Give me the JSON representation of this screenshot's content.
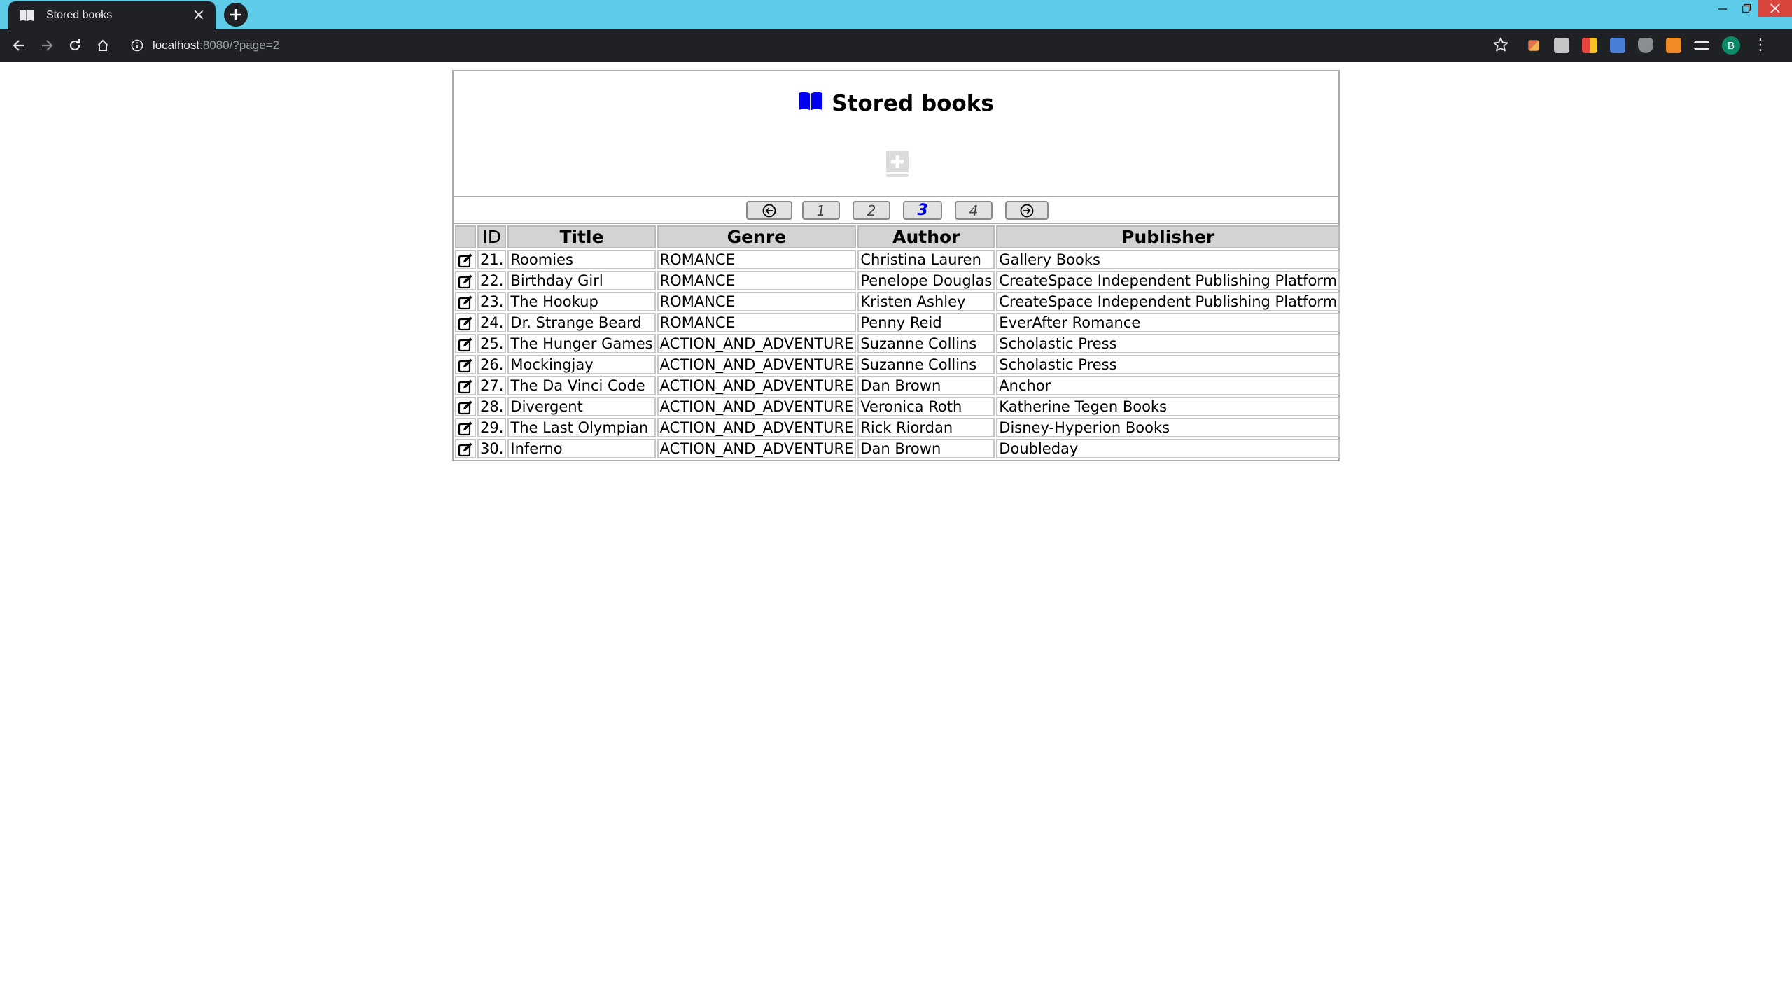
{
  "browser": {
    "tab_title": "Stored books",
    "url_host": "localhost",
    "url_rest": ":8080/?page=2",
    "profile_initial": "B"
  },
  "page": {
    "title": "Stored books",
    "pagination": {
      "prev_icon": "arrow-left-circle-icon",
      "next_icon": "arrow-right-circle-icon",
      "pages": [
        "1",
        "2",
        "3",
        "4"
      ],
      "current": "3"
    },
    "table": {
      "headers": {
        "id": "ID",
        "title": "Title",
        "genre": "Genre",
        "author": "Author",
        "publisher": "Publisher"
      },
      "rows": [
        {
          "id": "21.",
          "title": "Roomies",
          "genre": "ROMANCE",
          "author": "Christina Lauren",
          "publisher": "Gallery Books"
        },
        {
          "id": "22.",
          "title": "Birthday Girl",
          "genre": "ROMANCE",
          "author": "Penelope Douglas",
          "publisher": "CreateSpace Independent Publishing Platform"
        },
        {
          "id": "23.",
          "title": "The Hookup",
          "genre": "ROMANCE",
          "author": "Kristen Ashley",
          "publisher": "CreateSpace Independent Publishing Platform"
        },
        {
          "id": "24.",
          "title": "Dr. Strange Beard",
          "genre": "ROMANCE",
          "author": "Penny Reid",
          "publisher": "EverAfter Romance"
        },
        {
          "id": "25.",
          "title": "The Hunger Games",
          "genre": "ACTION_AND_ADVENTURE",
          "author": "Suzanne Collins",
          "publisher": "Scholastic Press"
        },
        {
          "id": "26.",
          "title": "Mockingjay",
          "genre": "ACTION_AND_ADVENTURE",
          "author": "Suzanne Collins",
          "publisher": "Scholastic Press"
        },
        {
          "id": "27.",
          "title": "The Da Vinci Code",
          "genre": "ACTION_AND_ADVENTURE",
          "author": "Dan Brown",
          "publisher": "Anchor"
        },
        {
          "id": "28.",
          "title": "Divergent",
          "genre": "ACTION_AND_ADVENTURE",
          "author": "Veronica Roth",
          "publisher": "Katherine Tegen Books"
        },
        {
          "id": "29.",
          "title": "The Last Olympian",
          "genre": "ACTION_AND_ADVENTURE",
          "author": "Rick Riordan",
          "publisher": "Disney-Hyperion Books"
        },
        {
          "id": "30.",
          "title": "Inferno",
          "genre": "ACTION_AND_ADVENTURE",
          "author": "Dan Brown",
          "publisher": "Doubleday"
        }
      ]
    }
  },
  "colors": {
    "titlebar": "#5ecbe8",
    "chrome_dark": "#202124",
    "link_current": "#0000ee",
    "book_icon": "#0000ee",
    "header_bg": "#d3d3d3"
  }
}
